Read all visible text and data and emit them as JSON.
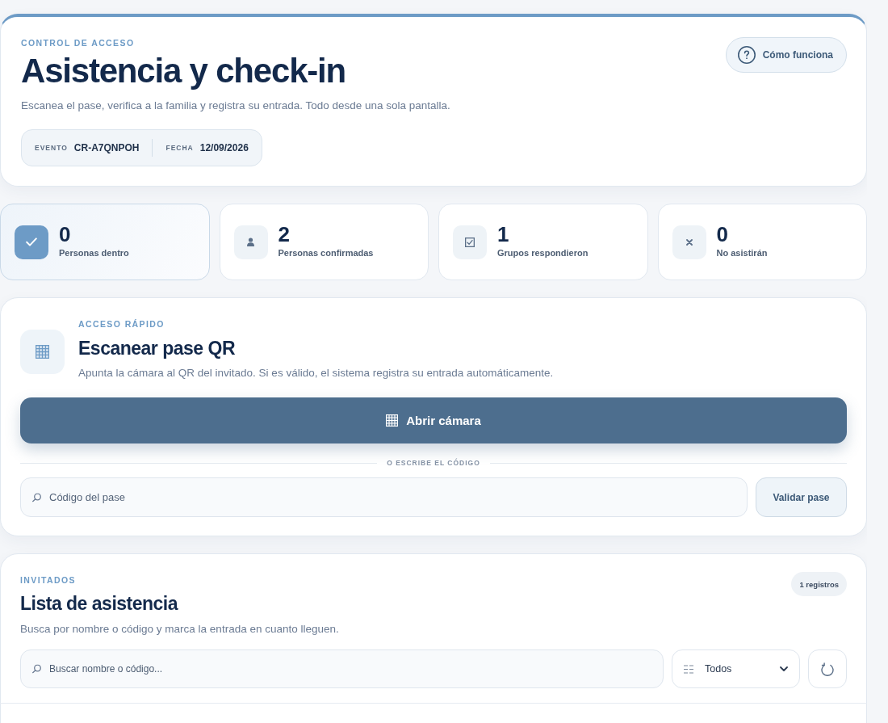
{
  "header": {
    "kicker": "CONTROL DE ACCESO",
    "title": "Asistencia y check-in",
    "subtitle": "Escanea el pase, verifica a la familia y registra su entrada. Todo desde una sola pantalla.",
    "help_button": "Cómo funciona",
    "meta": [
      {
        "label": "EVENTO",
        "value": "CR-A7QNPOH"
      },
      {
        "label": "FECHA",
        "value": "12/09/2026"
      }
    ]
  },
  "stats": [
    {
      "kind": "check",
      "value": "0",
      "label": "Personas dentro",
      "selected": true
    },
    {
      "kind": "person",
      "value": "2",
      "label": "Personas confirmadas",
      "selected": false
    },
    {
      "kind": "ballot",
      "value": "1",
      "label": "Grupos respondieron",
      "selected": false
    },
    {
      "kind": "cross",
      "value": "0",
      "label": "No asistirán",
      "selected": false
    }
  ],
  "scanner": {
    "kicker": "ACCESO RÁPIDO",
    "title": "Escanear pase QR",
    "description": "Apunta la cámara al QR del invitado. Si es válido, el sistema registra su entrada automáticamente.",
    "camera_button": "Abrir cámara",
    "divider": "O ESCRIBE EL CÓDIGO",
    "code_field": {
      "placeholder": "Código del pase"
    },
    "validate_button": "Validar pase"
  },
  "guest_list": {
    "kicker": "INVITADOS",
    "title": "Lista de asistencia",
    "description": "Busca por nombre o código y marca la entrada en cuanto lleguen.",
    "count_badge": "1 registros",
    "search": {
      "placeholder": "Buscar nombre o código..."
    },
    "filter": {
      "value": "Todos"
    }
  }
}
